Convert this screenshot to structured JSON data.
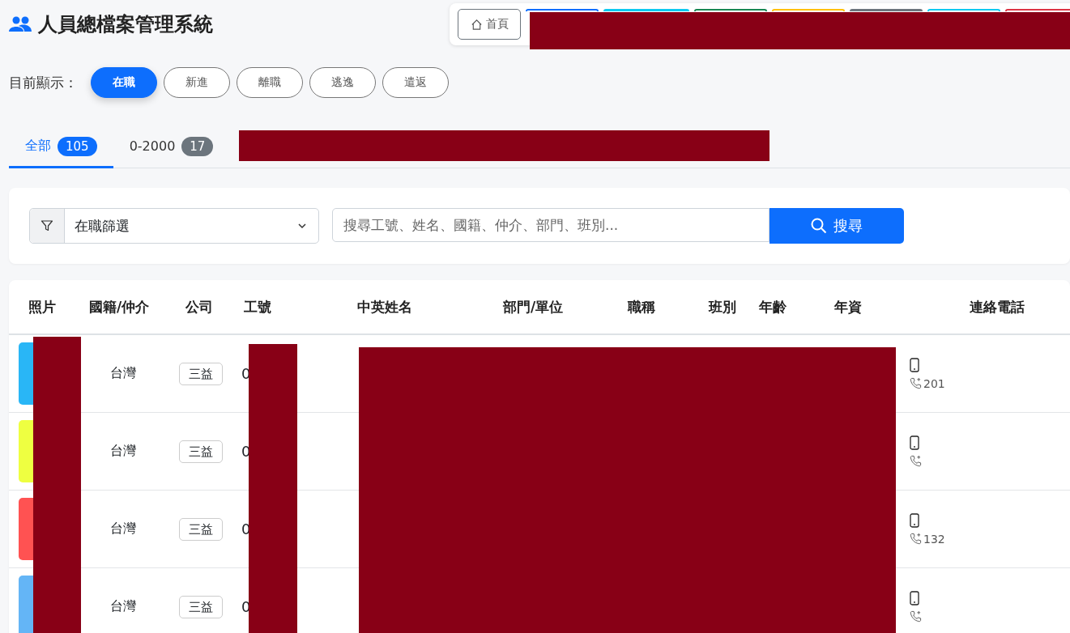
{
  "header": {
    "title": "人員總檔案管理系統"
  },
  "toolbar": [
    {
      "label": "首頁",
      "color": "#6c757d",
      "kind": "outline"
    },
    {
      "color": "#0d6efd",
      "kind": "outline"
    },
    {
      "color": "#0dcaf0",
      "kind": "solid"
    },
    {
      "color": "#198754",
      "kind": "outline"
    },
    {
      "color": "#ffc107",
      "kind": "outline"
    },
    {
      "color": "#6c757d",
      "kind": "solid"
    },
    {
      "color": "#0dcaf0",
      "kind": "outline"
    },
    {
      "color": "#dc3545",
      "kind": "outline"
    }
  ],
  "status_filter": {
    "label": "目前顯示：",
    "options": [
      {
        "label": "在職",
        "selected": true
      },
      {
        "label": "新進",
        "selected": false
      },
      {
        "label": "離職",
        "selected": false
      },
      {
        "label": "逃逸",
        "selected": false
      },
      {
        "label": "遣返",
        "selected": false
      }
    ]
  },
  "tabs": [
    {
      "label": "全部",
      "count": "105",
      "selected": true
    },
    {
      "label": "0-2000",
      "count": "17",
      "selected": false
    }
  ],
  "search": {
    "filter": "在職篩選",
    "placeholder": "搜尋工號、姓名、國籍、仲介、部門、班別...",
    "button": "搜尋"
  },
  "table": {
    "columns": [
      "照片",
      "國籍/仲介",
      "公司",
      "工號",
      "中英姓名",
      "部門/單位",
      "職稱",
      "班別",
      "年齡",
      "年資",
      "連絡電話"
    ],
    "rows": [
      {
        "color": "#29b6f6",
        "nationality": "台灣",
        "company": "三益",
        "id": "0",
        "extension": "201"
      },
      {
        "color": "#eeff41",
        "nationality": "台灣",
        "company": "三益",
        "id": "0"
      },
      {
        "color": "#ff5252",
        "nationality": "台灣",
        "company": "三益",
        "id": "0",
        "extension": "132"
      },
      {
        "color": "#64b5f6",
        "nationality": "台灣",
        "company": "三益",
        "id": "0"
      }
    ]
  }
}
